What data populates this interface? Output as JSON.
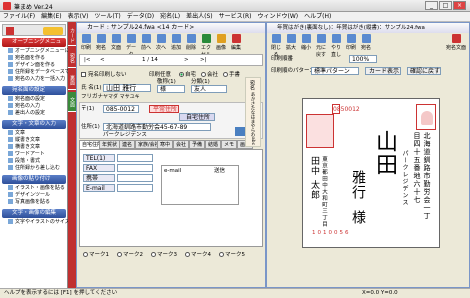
{
  "app": {
    "title": "筆まめ Ver.24",
    "win_min": "_",
    "win_max": "□",
    "win_close": "×"
  },
  "menu": [
    "ファイル(F)",
    "編集(E)",
    "表示(V)",
    "ツール(T)",
    "データ(D)",
    "宛名(L)",
    "差出人(S)",
    "サービス(R)",
    "ウィンドウ(W)",
    "ヘルプ(H)"
  ],
  "left": {
    "opening_menu": "オープニングメニュー",
    "section1": "宛名面の設定",
    "section2": "文字・文章の入力",
    "section3": "画像の貼り付け",
    "section4": "文字・画像の編集",
    "items_top": [
      "オープニングメニューに戻る",
      "宛名面を作る",
      "デザイン面を作る",
      "住所録をデータベースで管理する",
      "宛名の入力を一括入力"
    ],
    "items_s1": [
      "宛名面の設定",
      "宛名の入力",
      "差出人の設定"
    ],
    "items_s2": [
      "文章",
      "縦書き文章",
      "横書き文章",
      "ワードアート",
      "段落・書式",
      "住所録から差し込む"
    ],
    "items_s3": [
      "イラスト・画像を貼る",
      "デザインツール",
      "写真画像を貼る"
    ],
    "items_s4": [
      "文字やイラストのサイズ調整"
    ],
    "vtabs": [
      "カード",
      "宛名",
      "裏面",
      "文面"
    ]
  },
  "card": {
    "title": "カード : サンプル24.fwa",
    "sub": "<14 カード>",
    "toolbar": [
      "印刷",
      "宛名",
      "文面",
      "データ",
      "前へ",
      "次へ",
      "追加",
      "削除",
      "エクセル",
      "画像",
      "編集"
    ],
    "nav": [
      "|<",
      "<",
      "1 / 14",
      ">",
      ">|"
    ],
    "name_flag": "宛名印刷しない",
    "print_label": "印刷任意",
    "print_opts": [
      "自宅",
      "会社",
      "手書"
    ],
    "fields": {
      "title_label": "氏 名(1)",
      "name": "山田 雅行",
      "kana_label": "フリガナ",
      "kana": "ヤマダ マサユキ",
      "honor_label": "敬称(1)",
      "honor": "様",
      "rel_label": "分類(1)",
      "rel": "友人",
      "zip_label": "〒(1)",
      "zip": "085-0012",
      "home": "自宅住所",
      "work": "平常住所",
      "addr_label": "住所(1)",
      "addr1": "北海道釧路市勤労会45-67-89",
      "addr2": "パークレジデンス",
      "tel_label": "TEL(1)",
      "fax_label": "FAX",
      "mobile_label": "携帯",
      "email_label": "E-mail",
      "memo_title": "e-mail",
      "memo_send": "送信"
    },
    "tabs": [
      "自宅住所",
      "年賀状",
      "連名",
      "家族/会社",
      "寒中",
      "会社",
      "予備",
      "結婚",
      "メモ",
      "画像"
    ],
    "marks": [
      "マーク1",
      "マーク2",
      "マーク3",
      "マーク4",
      "マーク5"
    ],
    "right_side": [
      "宛名",
      "あかさたなはまやらわabc"
    ]
  },
  "preview": {
    "title": "年賀はがき(裏面なし)：年賀はがき(縦書)：サンプル24.fwa",
    "toolbar": [
      "閉じる",
      "拡大",
      "縮小",
      "元に戻す",
      "やり直し",
      "印刷",
      "宛名",
      "宛名面",
      "宛名文面"
    ],
    "layout_label": "印刷順番",
    "pattern_label": "印刷順のパターン",
    "pattern": "標準パターン",
    "card_btn": "カード表示",
    "check": "確認に戻す",
    "zoom": "100%",
    "postal_code": "0850012",
    "to_address": "北海道釧路市勤労会一丁目四十五番地六十七",
    "to_building": "パークレジデンス",
    "to_name_family": "山田",
    "to_name_given": "雅行",
    "to_honor": "様",
    "from_address": "東京都田中大和町三丁目",
    "from_name": "田中 太郎",
    "from_zip": "1010056",
    "show_pointer": "▼"
  },
  "status": {
    "help": "ヘルプを表示するには [F1] を押してください",
    "coords": "X=0.0 Y=0.0"
  },
  "colors": {
    "accent": "#c03030",
    "blue": "#2e4f9a"
  }
}
